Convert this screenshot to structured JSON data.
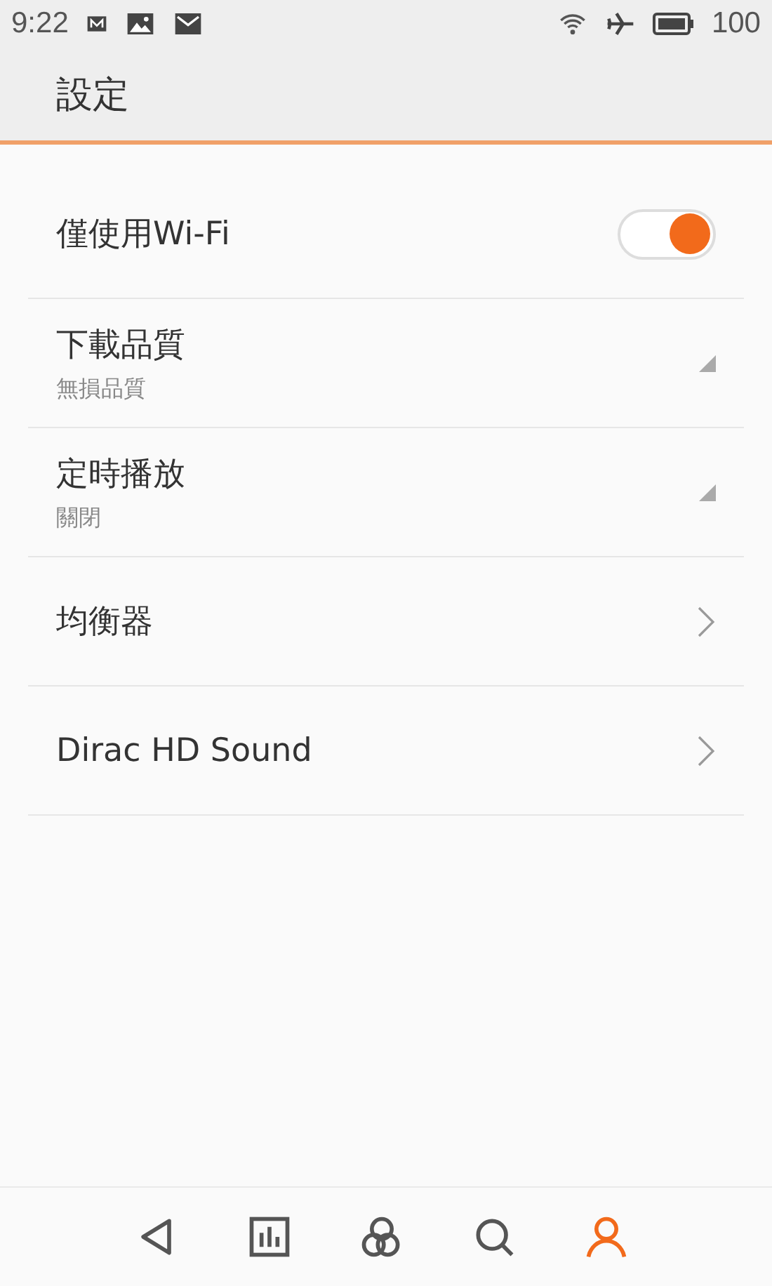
{
  "status_bar": {
    "time": "9:22",
    "battery": "100"
  },
  "header": {
    "title": "設定"
  },
  "settings": [
    {
      "kind": "toggle",
      "label": "僅使用Wi-Fi",
      "on": true
    },
    {
      "kind": "dropdown",
      "label": "下載品質",
      "value": "無損品質"
    },
    {
      "kind": "dropdown",
      "label": "定時播放",
      "value": "關閉"
    },
    {
      "kind": "link",
      "label": "均衡器"
    },
    {
      "kind": "link",
      "label": "Dirac HD Sound"
    }
  ],
  "nav": [
    {
      "kind": "back",
      "selected": false
    },
    {
      "kind": "chart",
      "selected": false
    },
    {
      "kind": "circles",
      "selected": false
    },
    {
      "kind": "search",
      "selected": false
    },
    {
      "kind": "person",
      "selected": true
    }
  ]
}
